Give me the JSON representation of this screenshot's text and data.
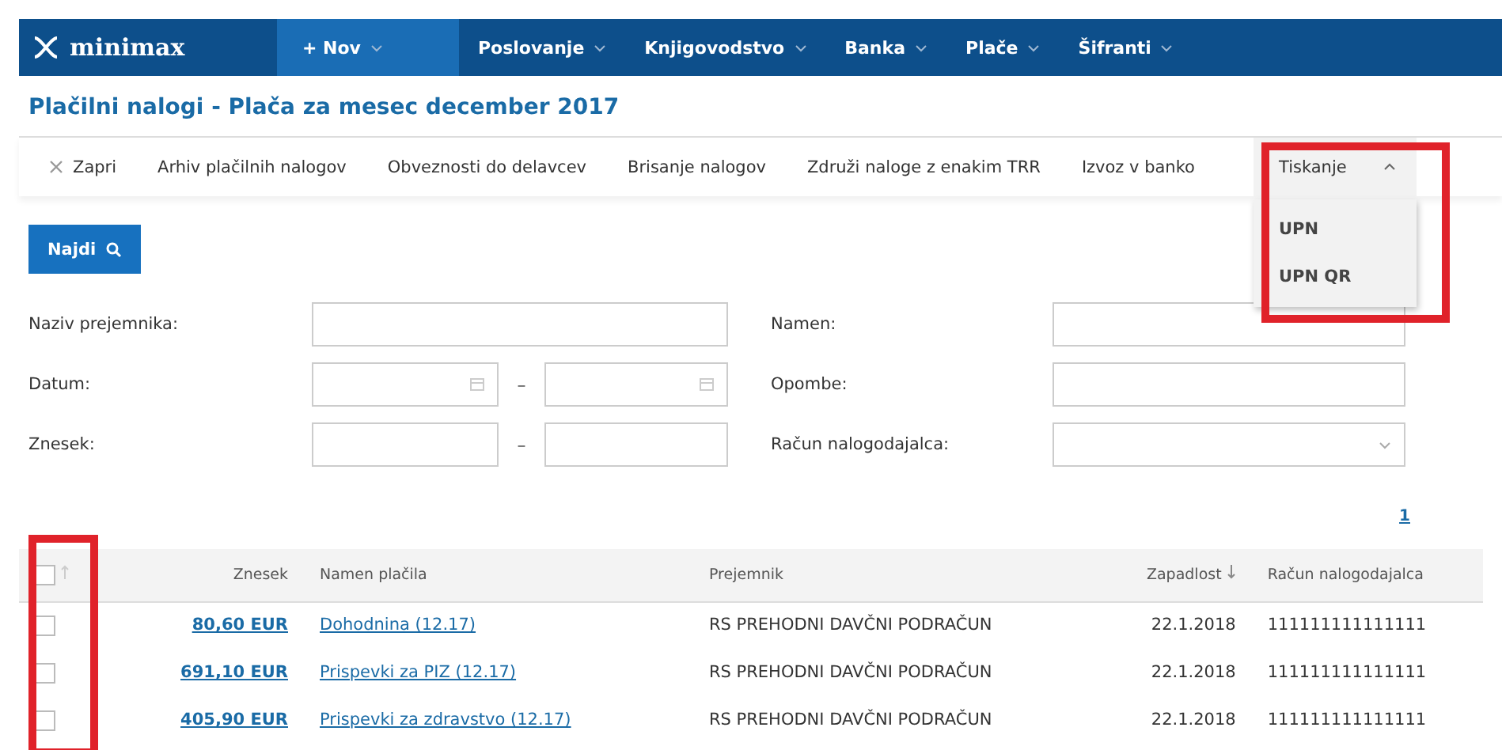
{
  "nav": {
    "logo": "minimax",
    "items": [
      {
        "label": "+ Nov",
        "kind": "new"
      },
      {
        "label": "Poslovanje",
        "kind": "menu"
      },
      {
        "label": "Knjigovodstvo",
        "kind": "menu"
      },
      {
        "label": "Banka",
        "kind": "menu"
      },
      {
        "label": "Plače",
        "kind": "menu"
      },
      {
        "label": "Šifranti",
        "kind": "menu"
      }
    ]
  },
  "title": "Plačilni nalogi - Plača za mesec december 2017",
  "toolbar": {
    "items": [
      {
        "label": "Zapri",
        "kind": "close"
      },
      {
        "label": "Arhiv plačilnih nalogov",
        "kind": "action"
      },
      {
        "label": "Obveznosti do delavcev",
        "kind": "action"
      },
      {
        "label": "Brisanje nalogov",
        "kind": "action"
      },
      {
        "label": "Združi naloge z enakim TRR",
        "kind": "action"
      },
      {
        "label": "Izvoz v banko",
        "kind": "action"
      },
      {
        "label": "Tiskanje",
        "kind": "dropdown",
        "expanded": true
      }
    ],
    "menu": [
      "UPN",
      "UPN QR"
    ]
  },
  "search_button": "Najdi",
  "filters": {
    "left": [
      {
        "label": "Naziv prejemnika:",
        "kind": "text"
      },
      {
        "label": "Datum:",
        "kind": "date_range",
        "separator": "–"
      },
      {
        "label": "Znesek:",
        "kind": "range",
        "separator": "–"
      }
    ],
    "right": [
      {
        "label": "Namen:",
        "kind": "text"
      },
      {
        "label": "Opombe:",
        "kind": "text"
      },
      {
        "label": "Račun nalogodajalca:",
        "kind": "select"
      }
    ]
  },
  "pagination": "1",
  "table": {
    "select_all_checked": false,
    "columns": [
      {
        "label": "Znesek",
        "kind": "amount",
        "sorted": false
      },
      {
        "label": "Namen plačila",
        "kind": "link",
        "sorted": false
      },
      {
        "label": "Prejemnik",
        "kind": "text",
        "sorted": false
      },
      {
        "label": "Zapadlost",
        "kind": "date",
        "sorted": true
      },
      {
        "label": "Račun nalogodajalca",
        "kind": "text",
        "sorted": false
      }
    ],
    "rows": [
      {
        "checked": false,
        "cells": [
          "80,60 EUR",
          "Dohodnina (12.17)",
          "RS PREHODNI DAVČNI PODRAČUN",
          "22.1.2018",
          "111111111111111"
        ]
      },
      {
        "checked": false,
        "cells": [
          "691,10 EUR",
          "Prispevki za PIZ (12.17)",
          "RS PREHODNI DAVČNI PODRAČUN",
          "22.1.2018",
          "111111111111111"
        ]
      },
      {
        "checked": false,
        "cells": [
          "405,90 EUR",
          "Prispevki za zdravstvo (12.17)",
          "RS PREHODNI DAVČNI PODRAČUN",
          "22.1.2018",
          "111111111111111"
        ]
      }
    ]
  }
}
